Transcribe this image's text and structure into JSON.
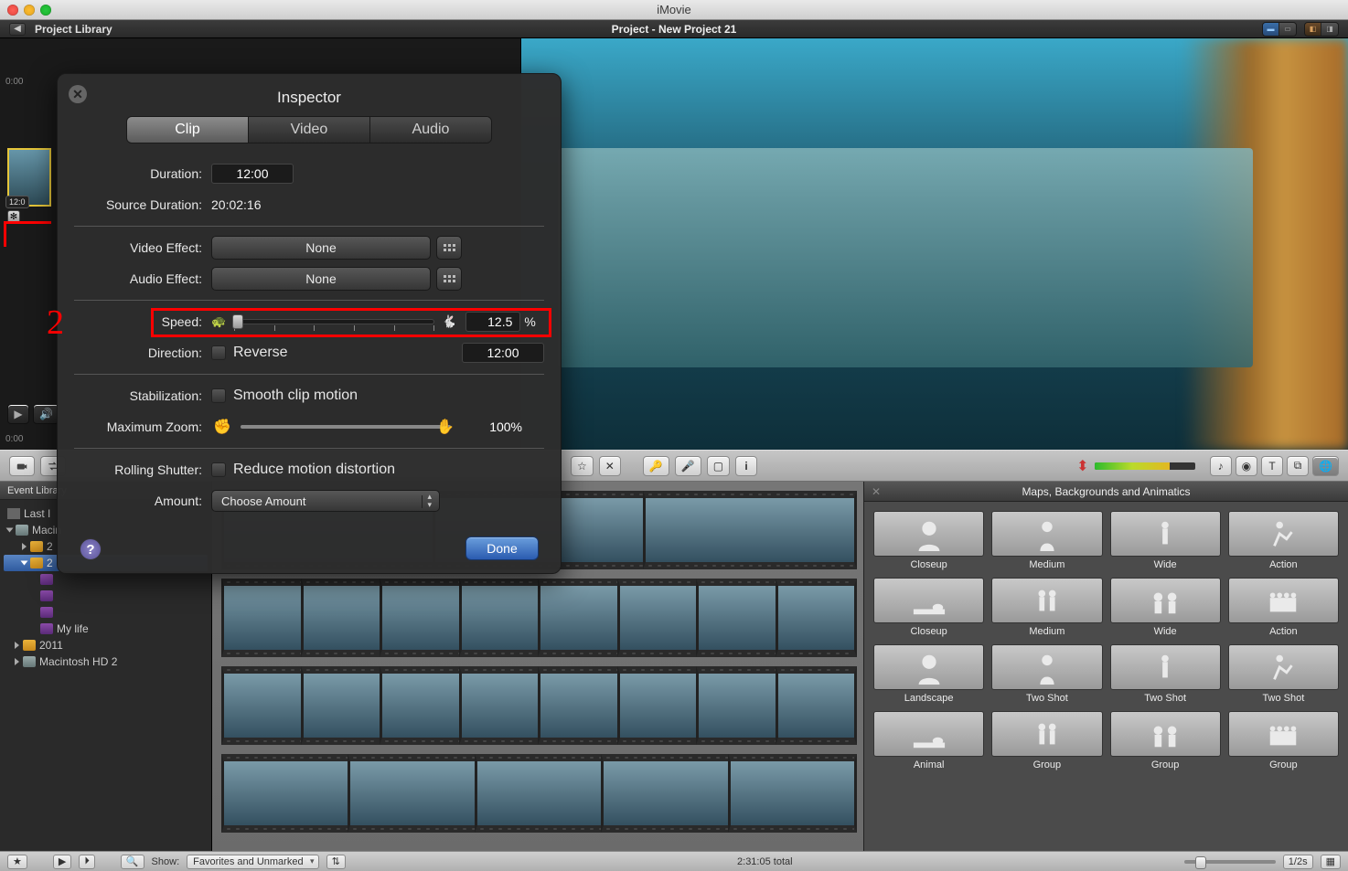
{
  "app_title": "iMovie",
  "toolbar": {
    "project_library": "Project Library",
    "project_title": "Project - New Project 21"
  },
  "preview": {},
  "mid_tools": {
    "star": "☆",
    "reject": "✕",
    "key": "⚿",
    "mic": "🎤",
    "crop": "▣",
    "info": "i"
  },
  "inspector": {
    "title": "Inspector",
    "tabs": {
      "clip": "Clip",
      "video": "Video",
      "audio": "Audio"
    },
    "duration_label": "Duration:",
    "duration_value": "12:00",
    "source_duration_label": "Source Duration:",
    "source_duration_value": "20:02:16",
    "video_effect_label": "Video Effect:",
    "video_effect_value": "None",
    "audio_effect_label": "Audio Effect:",
    "audio_effect_value": "None",
    "speed_label": "Speed:",
    "speed_value": "12.5",
    "speed_unit": "%",
    "direction_label": "Direction:",
    "direction_value": "Reverse",
    "direction_time": "12:00",
    "stabilization_label": "Stabilization:",
    "stabilization_value": "Smooth clip motion",
    "max_zoom_label": "Maximum Zoom:",
    "max_zoom_value": "100%",
    "rolling_shutter_label": "Rolling Shutter:",
    "rolling_shutter_value": "Reduce motion distortion",
    "amount_label": "Amount:",
    "amount_value": "Choose Amount",
    "done": "Done",
    "annotation_number": "2"
  },
  "event_library": {
    "header": "Event Library",
    "items": [
      {
        "label": "Last I",
        "type": "star"
      },
      {
        "label": "Macin",
        "type": "drive"
      },
      {
        "label": "2",
        "type": "cal",
        "indent": 1
      },
      {
        "label": "2",
        "type": "cal",
        "indent": 1,
        "selected": true
      },
      {
        "label": "",
        "type": "reel",
        "indent": 2
      },
      {
        "label": "",
        "type": "reel",
        "indent": 2
      },
      {
        "label": "",
        "type": "reel",
        "indent": 2
      },
      {
        "label": "My life",
        "type": "reel",
        "indent": 2
      },
      {
        "label": "2011",
        "type": "cal",
        "indent": 0
      },
      {
        "label": "Macintosh HD 2",
        "type": "drive",
        "indent": 0
      }
    ]
  },
  "maps_panel": {
    "title": "Maps, Backgrounds and Animatics",
    "items": [
      "Closeup",
      "Medium",
      "Wide",
      "Action",
      "Closeup",
      "Medium",
      "Wide",
      "Action",
      "Landscape",
      "Two Shot",
      "Two Shot",
      "Two Shot",
      "Animal",
      "Group",
      "Group",
      "Group"
    ]
  },
  "statusbar": {
    "show_label": "Show:",
    "filter": "Favorites and Unmarked",
    "total": "2:31:05 total",
    "thumb_size": "1/2s"
  },
  "timeline": {
    "start": "0:00",
    "end": "0:00",
    "clip_badge": "12:0"
  }
}
